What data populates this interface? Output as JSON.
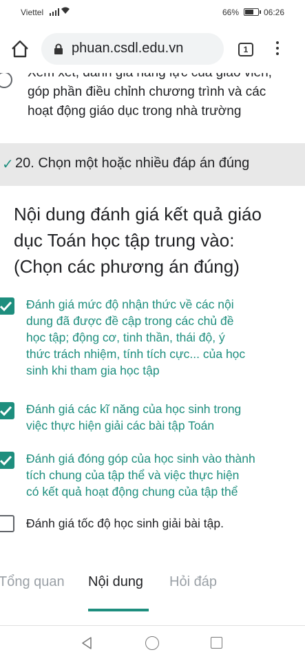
{
  "status_bar": {
    "carrier": "Viettel",
    "battery_percent": "66%",
    "time": "06:26"
  },
  "browser": {
    "url": "phuan.csdl.edu.vn",
    "tab_count": "1"
  },
  "previous_option": {
    "lines": [
      "Xem xét, đánh giá năng lực của giáo viên,",
      "góp phần điều chỉnh chương trình và các",
      "hoạt động giáo dục trong nhà trường"
    ]
  },
  "question": {
    "header": "20. Chọn một hoặc nhiều đáp án đúng",
    "text_lines": [
      "Nội dung đánh giá kết quả giáo",
      "dục Toán học  tập trung vào:",
      "(Chọn  các phương án đúng)"
    ],
    "options": [
      {
        "checked": true,
        "lines": [
          "Đánh giá mức độ nhận thức về các nội",
          "dung đã được đề cập trong các chủ đề",
          "học tập; động cơ, tinh thần, thái độ, ý",
          "thức trách nhiệm, tính tích cực... của học",
          "sinh khi tham gia học tập"
        ]
      },
      {
        "checked": true,
        "lines": [
          "Đánh giá các kĩ năng của học sinh trong",
          "việc thực hiện giải các bài tập Toán"
        ]
      },
      {
        "checked": true,
        "lines": [
          "Đánh giá đóng góp của học sinh vào thành",
          "tích chung của tập thể và việc thực hiện",
          "có kết quả hoạt động chung của tập thể"
        ]
      },
      {
        "checked": false,
        "lines": [
          "Đánh giá tốc độ học sinh giải bài tập."
        ]
      }
    ]
  },
  "tabs": [
    {
      "label": "Tổng quan",
      "active": false
    },
    {
      "label": "Nội dung",
      "active": true
    },
    {
      "label": "Hỏi đáp",
      "active": false
    }
  ],
  "colors": {
    "accent": "#1e8e7e",
    "header_bg": "#e8e8e8"
  }
}
